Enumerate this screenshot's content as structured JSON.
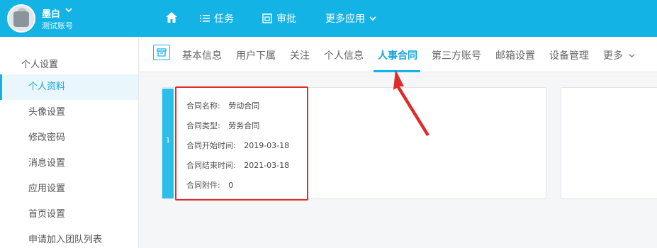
{
  "user": {
    "name": "墨白",
    "subtitle": "测试账号"
  },
  "nav": {
    "tasks": "任务",
    "approval": "审批",
    "more_apps": "更多应用"
  },
  "sidebar": {
    "title": "个人设置",
    "items": [
      {
        "label": "个人资料",
        "active": true
      },
      {
        "label": "头像设置"
      },
      {
        "label": "修改密码"
      },
      {
        "label": "消息设置"
      },
      {
        "label": "应用设置"
      },
      {
        "label": "首页设置"
      },
      {
        "label": "申请加入团队列表"
      }
    ]
  },
  "tabs": [
    {
      "label": "基本信息"
    },
    {
      "label": "用户下属"
    },
    {
      "label": "关注"
    },
    {
      "label": "个人信息"
    },
    {
      "label": "人事合同",
      "active": true
    },
    {
      "label": "第三方账号"
    },
    {
      "label": "邮箱设置"
    },
    {
      "label": "设备管理"
    },
    {
      "label": "更多"
    }
  ],
  "contract": {
    "index": "1",
    "fields": [
      {
        "label": "合同名称:",
        "value": "劳动合同"
      },
      {
        "label": "合同类型:",
        "value": "劳务合同"
      },
      {
        "label": "合同开始时间:",
        "value": "2019-03-18"
      },
      {
        "label": "合同结束时间:",
        "value": "2021-03-18"
      },
      {
        "label": "合同附件:",
        "value": "0"
      }
    ]
  },
  "colors": {
    "primary": "#14b3e6",
    "annotation": "#e02b2b"
  }
}
